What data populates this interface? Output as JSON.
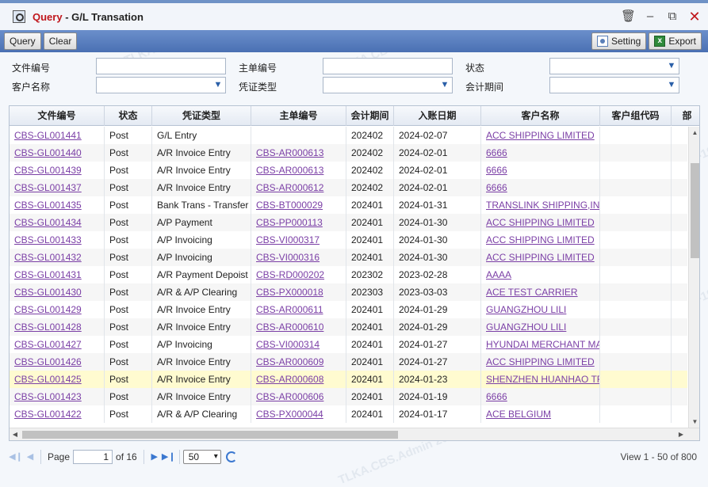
{
  "window": {
    "title_query": "Query",
    "title_rest": " - G/L Transation",
    "icons": [
      "trash-icon",
      "minimize-icon",
      "maximize-icon",
      "close-icon"
    ]
  },
  "toolbar": {
    "query_label": "Query",
    "clear_label": "Clear",
    "setting_label": "Setting",
    "export_label": "Export"
  },
  "filter": {
    "doc_no_label": "文件编号",
    "master_no_label": "主单编号",
    "status_label": "状态",
    "customer_label": "客户名称",
    "voucher_type_label": "凭证类型",
    "period_label": "会计期间"
  },
  "grid": {
    "headers": [
      "文件编号",
      "状态",
      "凭证类型",
      "主单编号",
      "会计期间",
      "入账日期",
      "客户名称",
      "客户组代码",
      "部"
    ],
    "rows": [
      [
        "CBS-GL001441",
        "Post",
        "G/L Entry",
        "",
        "202402",
        "2024-02-07",
        "ACC SHIPPING LIMITED",
        ""
      ],
      [
        "CBS-GL001440",
        "Post",
        "A/R Invoice Entry",
        "CBS-AR000613",
        "202402",
        "2024-02-01",
        "6666",
        ""
      ],
      [
        "CBS-GL001439",
        "Post",
        "A/R Invoice Entry",
        "CBS-AR000613",
        "202402",
        "2024-02-01",
        "6666",
        ""
      ],
      [
        "CBS-GL001437",
        "Post",
        "A/R Invoice Entry",
        "CBS-AR000612",
        "202402",
        "2024-02-01",
        "6666",
        ""
      ],
      [
        "CBS-GL001435",
        "Post",
        "Bank Trans - Transfer",
        "CBS-BT000029",
        "202401",
        "2024-01-31",
        "TRANSLINK SHIPPING,IN",
        ""
      ],
      [
        "CBS-GL001434",
        "Post",
        "A/P Payment",
        "CBS-PP000113",
        "202401",
        "2024-01-30",
        "ACC SHIPPING LIMITED",
        ""
      ],
      [
        "CBS-GL001433",
        "Post",
        "A/P Invoicing",
        "CBS-VI000317",
        "202401",
        "2024-01-30",
        "ACC SHIPPING LIMITED",
        ""
      ],
      [
        "CBS-GL001432",
        "Post",
        "A/P Invoicing",
        "CBS-VI000316",
        "202401",
        "2024-01-30",
        "ACC SHIPPING LIMITED",
        ""
      ],
      [
        "CBS-GL001431",
        "Post",
        "A/R Payment Depoist",
        "CBS-RD000202",
        "202302",
        "2023-02-28",
        "AAAA",
        ""
      ],
      [
        "CBS-GL001430",
        "Post",
        "A/R & A/P Clearing",
        "CBS-PX000018",
        "202303",
        "2023-03-03",
        "ACE TEST CARRIER",
        ""
      ],
      [
        "CBS-GL001429",
        "Post",
        "A/R Invoice Entry",
        "CBS-AR000611",
        "202401",
        "2024-01-29",
        "GUANGZHOU LILI",
        ""
      ],
      [
        "CBS-GL001428",
        "Post",
        "A/R Invoice Entry",
        "CBS-AR000610",
        "202401",
        "2024-01-29",
        "GUANGZHOU LILI",
        ""
      ],
      [
        "CBS-GL001427",
        "Post",
        "A/P Invoicing",
        "CBS-VI000314",
        "202401",
        "2024-01-27",
        "HYUNDAI MERCHANT MA",
        ""
      ],
      [
        "CBS-GL001426",
        "Post",
        "A/R Invoice Entry",
        "CBS-AR000609",
        "202401",
        "2024-01-27",
        "ACC SHIPPING LIMITED",
        ""
      ],
      [
        "CBS-GL001425",
        "Post",
        "A/R Invoice Entry",
        "CBS-AR000608",
        "202401",
        "2024-01-23",
        "SHENZHEN HUANHAO TR",
        ""
      ],
      [
        "CBS-GL001423",
        "Post",
        "A/R Invoice Entry",
        "CBS-AR000606",
        "202401",
        "2024-01-19",
        "6666",
        ""
      ],
      [
        "CBS-GL001422",
        "Post",
        "A/R & A/P Clearing",
        "CBS-PX000044",
        "202401",
        "2024-01-17",
        "ACE BELGIUM",
        ""
      ]
    ],
    "selected_row_index": 14
  },
  "pager": {
    "page_label": "Page",
    "page_value": "1",
    "of_label": "of 16",
    "page_size": "50",
    "info": "View 1 - 50 of 800"
  },
  "watermark": "TLKA.CBS.Admin 2024-02-19"
}
